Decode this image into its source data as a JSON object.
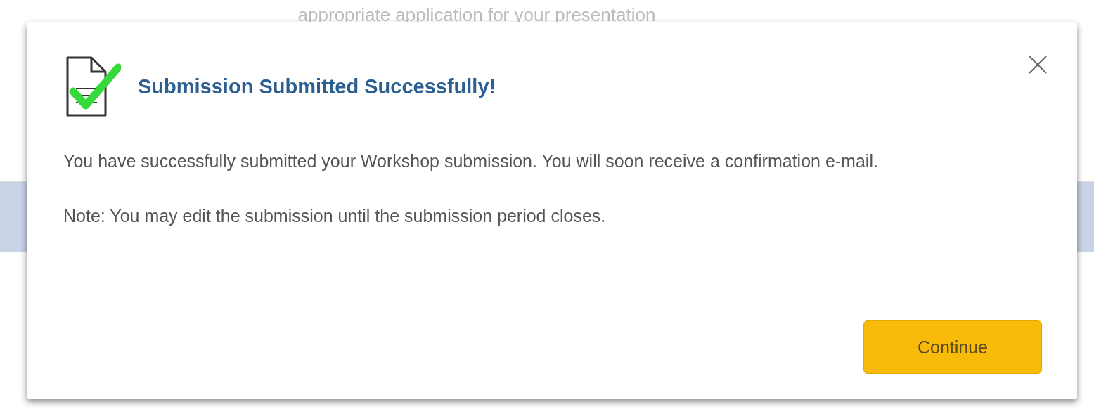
{
  "background": {
    "text": "appropriate application for your presentation"
  },
  "dialog": {
    "title": "Submission Submitted Successfully!",
    "paragraphs": [
      "You have successfully submitted your Workshop submission. You will soon receive a confirmation e-mail.",
      "Note: You may edit the submission until the submission period closes."
    ],
    "buttons": [
      "Continue"
    ]
  }
}
